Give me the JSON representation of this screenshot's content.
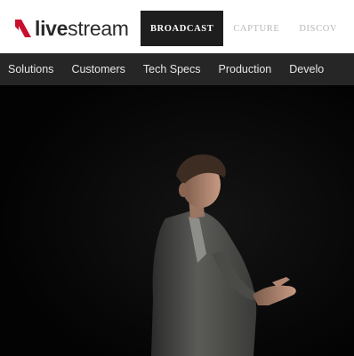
{
  "brand": {
    "name_bold": "live",
    "name_regular": "stream",
    "accent_color": "#c8102e",
    "logo_icon": "livestream-logo-icon"
  },
  "product_tabs": [
    {
      "label": "BROADCAST",
      "active": true
    },
    {
      "label": "CAPTURE",
      "active": false
    },
    {
      "label": "DISCOV",
      "active": false
    }
  ],
  "subnav": {
    "items": [
      "Solutions",
      "Customers",
      "Tech Specs",
      "Production",
      "Develo"
    ]
  },
  "hero": {
    "subject": "speaker-on-dark-stage-photo",
    "background_color": "#050505"
  }
}
